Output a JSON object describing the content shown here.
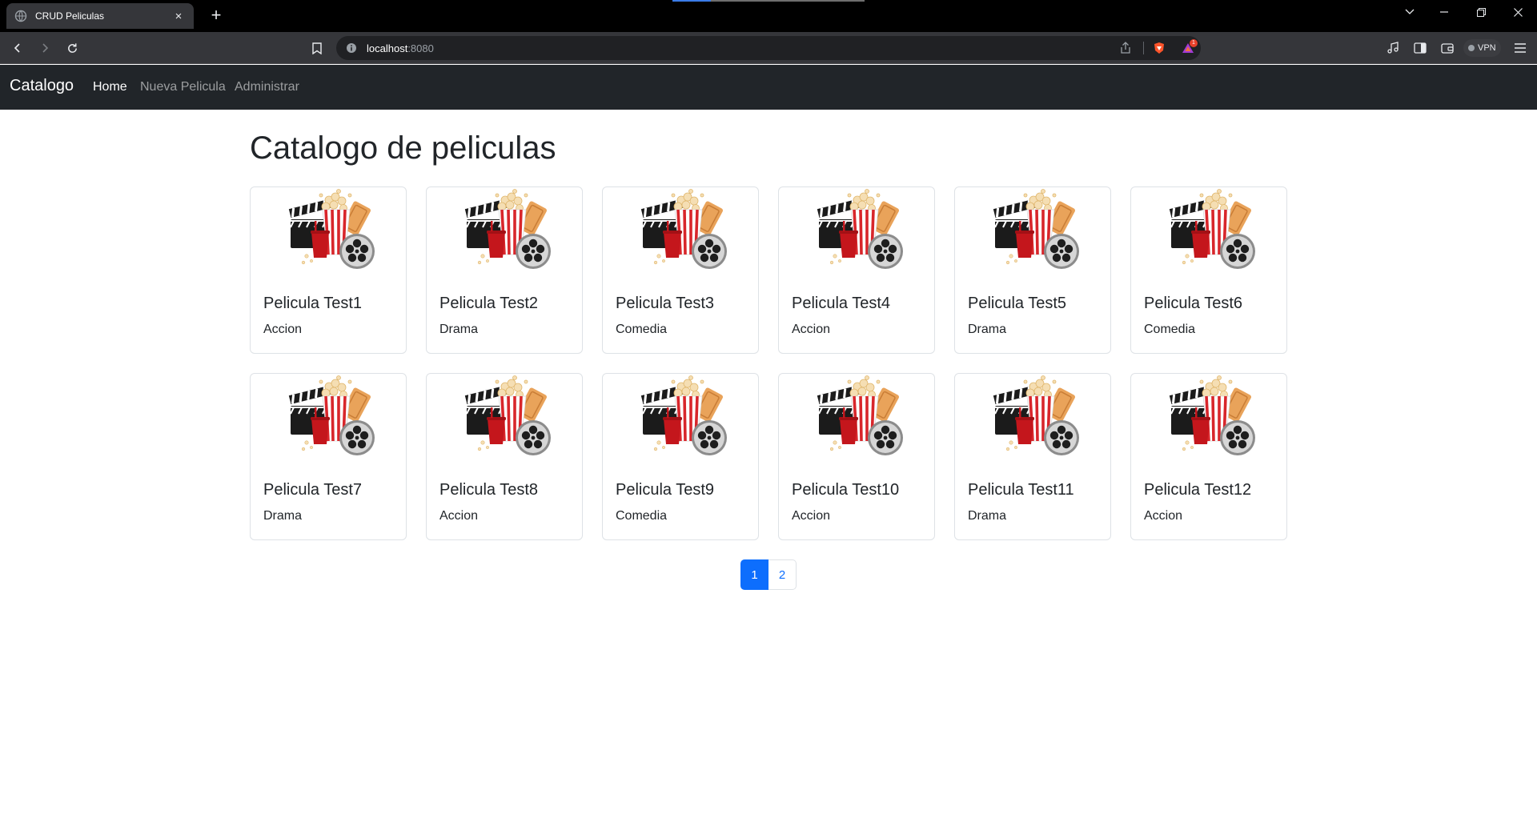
{
  "browser": {
    "tab_title": "CRUD Peliculas",
    "tab_close": "×",
    "new_tab": "+",
    "url_host": "localhost",
    "url_port": ":8080",
    "vpn_label": "VPN",
    "notification_count": "1"
  },
  "navbar": {
    "brand": "Catalogo",
    "links": [
      {
        "label": "Home",
        "active": true
      },
      {
        "label": "Nueva Pelicula",
        "active": false
      },
      {
        "label": "Administrar",
        "active": false
      }
    ]
  },
  "main": {
    "heading": "Catalogo de peliculas",
    "movies": [
      {
        "title": "Pelicula Test1",
        "genre": "Accion"
      },
      {
        "title": "Pelicula Test2",
        "genre": "Drama"
      },
      {
        "title": "Pelicula Test3",
        "genre": "Comedia"
      },
      {
        "title": "Pelicula Test4",
        "genre": "Accion"
      },
      {
        "title": "Pelicula Test5",
        "genre": "Drama"
      },
      {
        "title": "Pelicula Test6",
        "genre": "Comedia"
      },
      {
        "title": "Pelicula Test7",
        "genre": "Drama"
      },
      {
        "title": "Pelicula Test8",
        "genre": "Accion"
      },
      {
        "title": "Pelicula Test9",
        "genre": "Comedia"
      },
      {
        "title": "Pelicula Test10",
        "genre": "Accion"
      },
      {
        "title": "Pelicula Test11",
        "genre": "Drama"
      },
      {
        "title": "Pelicula Test12",
        "genre": "Accion"
      }
    ],
    "pagination": [
      "1",
      "2"
    ],
    "current_page": "1"
  },
  "colors": {
    "navbar_bg": "#212529",
    "accent": "#0d6efd"
  }
}
